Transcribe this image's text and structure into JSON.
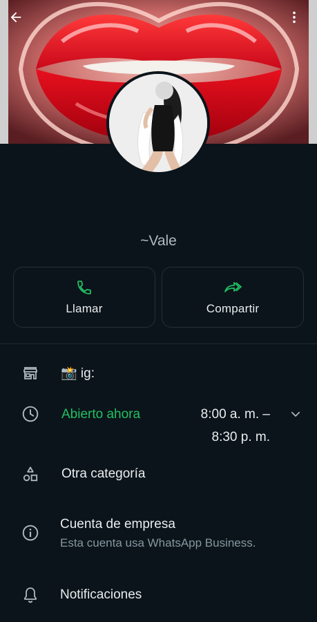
{
  "header": {
    "back_icon": "arrow-left-icon",
    "more_icon": "more-vertical-icon"
  },
  "profile": {
    "name": "~Vale"
  },
  "actions": {
    "call": {
      "label": "Llamar",
      "icon": "phone-icon",
      "color": "#21c063"
    },
    "share": {
      "label": "Compartir",
      "icon": "forward-icon",
      "color": "#21c063"
    }
  },
  "details": {
    "ig": {
      "icon": "store-icon",
      "text": "📸 ig:"
    },
    "hours": {
      "icon": "clock-icon",
      "status": "Abierto ahora",
      "status_color": "#21c063",
      "range_line1": "8:00 a. m. –",
      "range_line2": "8:30 p. m."
    },
    "category": {
      "icon": "shapes-icon",
      "text": "Otra categoría"
    },
    "business": {
      "icon": "info-icon",
      "title": "Cuenta de empresa",
      "subtitle": "Esta cuenta usa WhatsApp Business."
    },
    "notifications": {
      "icon": "bell-icon",
      "text": "Notificaciones"
    }
  },
  "colors": {
    "background": "#0b141a",
    "accent": "#21c063",
    "secondary_text": "#8696a0"
  }
}
